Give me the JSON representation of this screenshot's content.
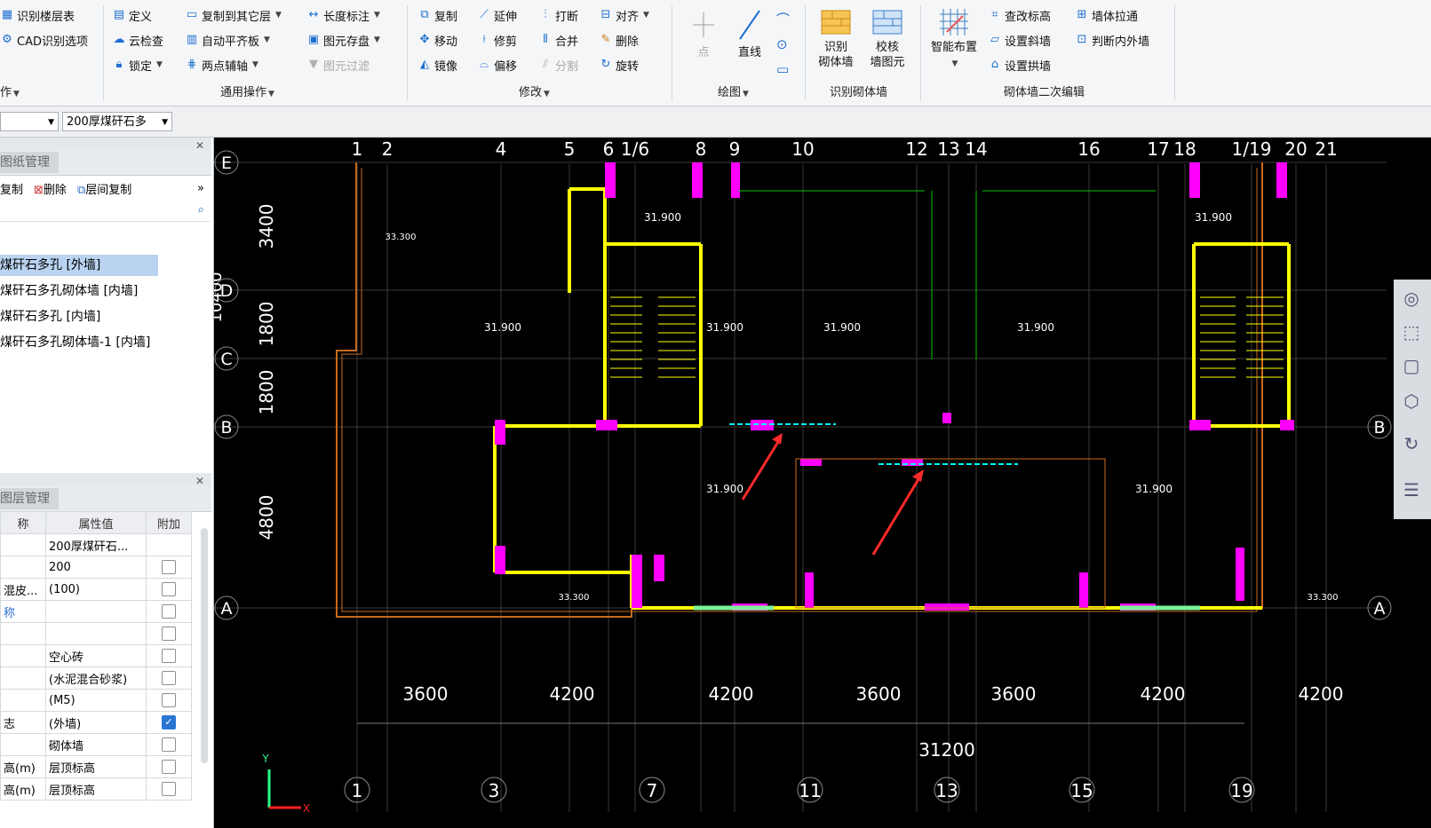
{
  "ribbon": {
    "left_items": [
      "识别楼层表",
      "CAD识别选项"
    ],
    "left_group": "作",
    "general_ops": {
      "items": [
        "定义",
        "云检查",
        "锁定",
        "复制到其它层",
        "自动平齐板",
        "两点辅轴",
        "长度标注",
        "图元存盘",
        "图元过滤"
      ],
      "label": "通用操作"
    },
    "modify": {
      "items": [
        "复制",
        "移动",
        "镜像",
        "延伸",
        "修剪",
        "偏移",
        "打断",
        "合并",
        "分割",
        "对齐",
        "删除",
        "旋转"
      ],
      "label": "修改"
    },
    "draw": {
      "items": [
        "点",
        "直线"
      ],
      "label": "绘图"
    },
    "recognize": {
      "btn1": [
        "识别",
        "砌体墙"
      ],
      "btn2": [
        "校核",
        "墙图元"
      ],
      "label": "识别砌体墙"
    },
    "secondary": {
      "smart": "智能布置",
      "items": [
        "查改标高",
        "设置斜墙",
        "设置拱墙",
        "墙体拉通",
        "判断内外墙"
      ],
      "label": "砌体墙二次编辑"
    }
  },
  "subbar": {
    "combo2": "200厚煤矸石多"
  },
  "drawing_panel": {
    "title": "图纸管理",
    "tools": [
      "复制",
      "删除",
      "层间复制"
    ],
    "items": [
      "煤矸石多孔 [外墙]",
      "煤矸石多孔砌体墙 [内墙]",
      "煤矸石多孔 [内墙]",
      "煤矸石多孔砌体墙-1 [内墙]"
    ],
    "selected": 0
  },
  "props_panel": {
    "title": "图层管理",
    "headers": [
      "称",
      "属性值",
      "附加"
    ],
    "rows": [
      {
        "name": "",
        "value": "200厚煤矸石...",
        "checkbox": false,
        "has_check": false
      },
      {
        "name": "",
        "value": "200",
        "checkbox": false,
        "has_check": true
      },
      {
        "name": "混皮...",
        "value": "(100)",
        "checkbox": false,
        "has_check": true
      },
      {
        "name": "称",
        "value": "",
        "checkbox": false,
        "has_check": true
      },
      {
        "name": "",
        "value": "",
        "checkbox": false,
        "has_check": true
      },
      {
        "name": "",
        "value": "空心砖",
        "checkbox": false,
        "has_check": true
      },
      {
        "name": "",
        "value": "(水泥混合砂浆)",
        "checkbox": false,
        "has_check": true
      },
      {
        "name": "",
        "value": "(M5)",
        "checkbox": false,
        "has_check": true
      },
      {
        "name": "志",
        "value": "(外墙)",
        "checkbox": true,
        "has_check": true
      },
      {
        "name": "",
        "value": "砌体墙",
        "checkbox": false,
        "has_check": true
      },
      {
        "name": "高(m)",
        "value": "层顶标高",
        "checkbox": false,
        "has_check": true
      },
      {
        "name": "高(m)",
        "value": "层顶标高",
        "checkbox": false,
        "has_check": true
      }
    ]
  },
  "cad": {
    "top_axes": [
      "1",
      "2",
      "4",
      "5",
      "6",
      "1/6",
      "8",
      "9",
      "10",
      "12",
      "13",
      "14",
      "16",
      "17",
      "18",
      "1/19",
      "20",
      "21"
    ],
    "bottom_axes": [
      "1",
      "3",
      "7",
      "11",
      "13",
      "15",
      "19"
    ],
    "left_axes": [
      "E",
      "D",
      "C",
      "B",
      "A"
    ],
    "left_dims": [
      "3400",
      "1800",
      "1800",
      "4800"
    ],
    "left_total": "10400",
    "bottom_dims": [
      "3600",
      "4200",
      "4200",
      "3600",
      "3600",
      "4200",
      "4200"
    ],
    "total": "31200",
    "elevations": [
      "31.900",
      "31.900",
      "31.900",
      "31.900",
      "31.900",
      "31.900",
      "31.900",
      "31.900"
    ],
    "elev_33": [
      "33.300",
      "33.300",
      "33.300"
    ]
  },
  "colors": {
    "magenta": "#ff00ff",
    "yellow": "#ffff00",
    "cyan": "#00ffff",
    "green": "#00c800",
    "red": "#ff2a2a",
    "white": "#ffffff"
  }
}
